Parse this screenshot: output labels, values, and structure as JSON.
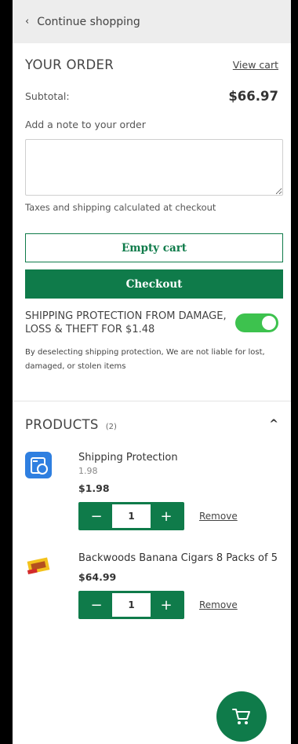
{
  "top_bar": {
    "back_label": "Continue shopping"
  },
  "order": {
    "title": "YOUR ORDER",
    "view_cart": "View cart",
    "subtotal_label": "Subtotal:",
    "subtotal_value": "$66.97",
    "note_label": "Add a note to your order",
    "note_value": "",
    "taxes_text": "Taxes and shipping calculated at checkout",
    "empty_cart_label": "Empty cart",
    "checkout_label": "Checkout",
    "protection_label": "SHIPPING PROTECTION FROM DAMAGE, LOSS & THEFT FOR $1.48",
    "protection_enabled": true,
    "protection_note": "By deselecting shipping protection, We are not liable for lost, damaged, or stolen items"
  },
  "products": {
    "title": "PRODUCTS",
    "count": "(2)",
    "items": [
      {
        "name": "Shipping Protection",
        "variant": "1.98",
        "price": "$1.98",
        "qty": "1",
        "remove_label": "Remove",
        "icon": "shield-box-icon"
      },
      {
        "name": "Backwoods Banana Cigars 8 Packs of 5",
        "variant": "",
        "price": "$64.99",
        "qty": "1",
        "remove_label": "Remove",
        "icon": "cigar-pack-image"
      }
    ]
  },
  "colors": {
    "accent": "#0f7b4a",
    "toggle_on": "#3dc24e"
  },
  "fab": {
    "icon": "cart-icon"
  }
}
